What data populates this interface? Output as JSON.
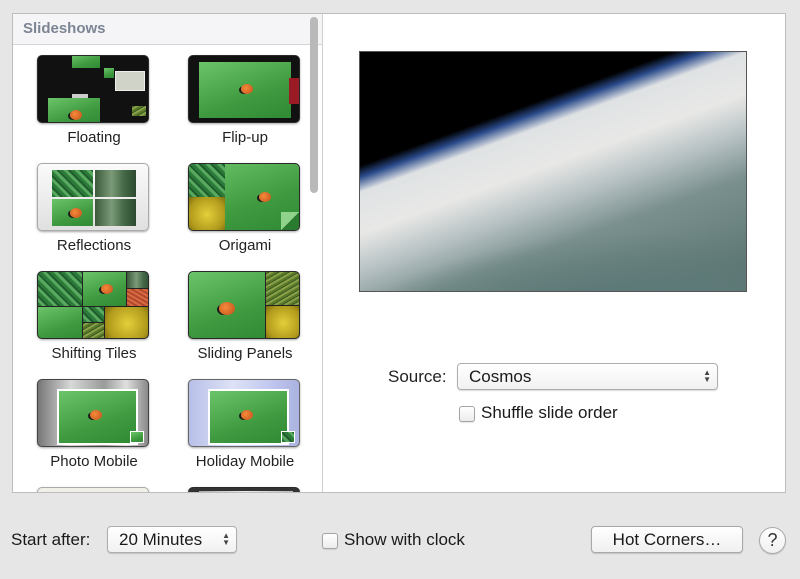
{
  "slideshows": {
    "header": "Slideshows",
    "items": [
      {
        "label": "Floating"
      },
      {
        "label": "Flip-up"
      },
      {
        "label": "Reflections"
      },
      {
        "label": "Origami"
      },
      {
        "label": "Shifting Tiles"
      },
      {
        "label": "Sliding Panels"
      },
      {
        "label": "Photo Mobile"
      },
      {
        "label": "Holiday Mobile"
      }
    ]
  },
  "preview": {
    "description": "Earth from orbit (Cosmos)"
  },
  "source": {
    "label": "Source:",
    "value": "Cosmos",
    "shuffle_label": "Shuffle slide order",
    "shuffle_checked": false
  },
  "footer": {
    "start_after_label": "Start after:",
    "start_after_value": "20 Minutes",
    "show_clock_label": "Show with clock",
    "show_clock_checked": false,
    "hot_corners_label": "Hot Corners…",
    "help_label": "?"
  }
}
